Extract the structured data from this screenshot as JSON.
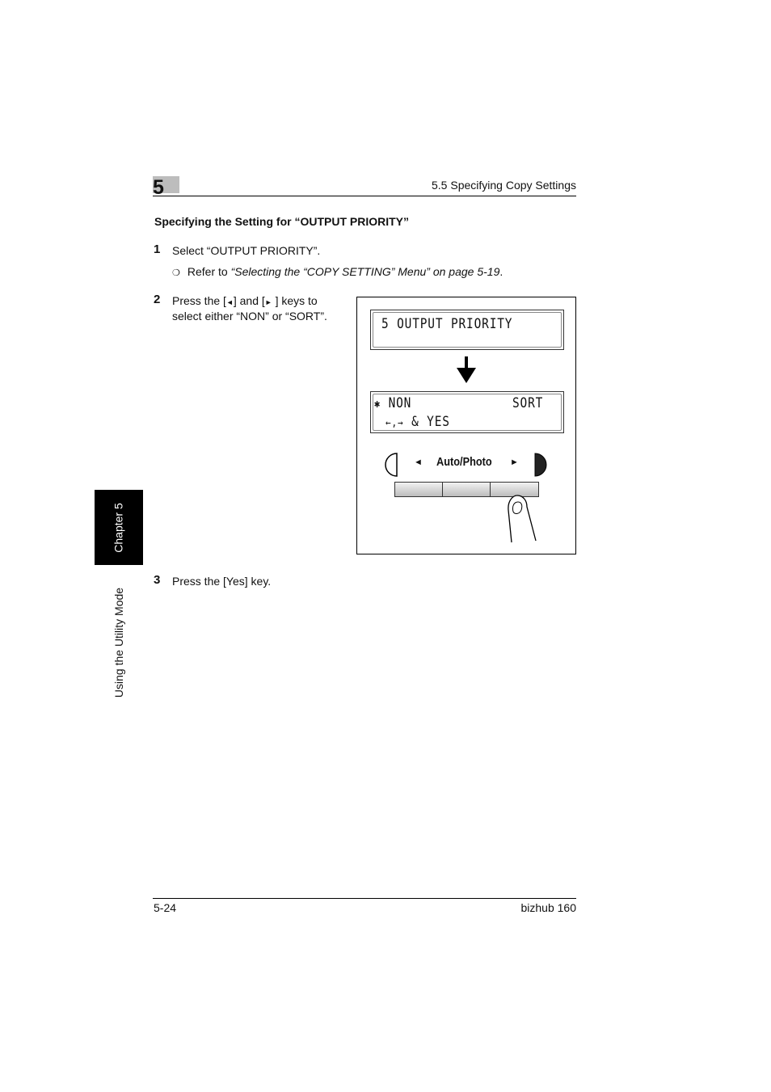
{
  "header": {
    "chapter_number": "5",
    "section_title": "5.5 Specifying Copy Settings"
  },
  "section": {
    "title": "Specifying the Setting for “OUTPUT PRIORITY”"
  },
  "steps": [
    {
      "number": "1",
      "text": "Select “OUTPUT PRIORITY”.",
      "sub": {
        "bullet": "❍",
        "prefix": "Refer to ",
        "link": "“Selecting the “COPY SETTING” Menu” on page 5-19",
        "suffix": "."
      }
    },
    {
      "number": "2",
      "text_line1_a": "Press the [",
      "left_key_icon": "◄",
      "text_line1_b": "] and [",
      "right_key_icon": "►",
      "text_line1_c": " ] keys to",
      "text_line2": "select either “NON” or “SORT”."
    },
    {
      "number": "3",
      "text": "Press the [Yes] key."
    }
  ],
  "figure": {
    "lcd1": {
      "line1": "5  OUTPUT PRIORITY"
    },
    "lcd2": {
      "marker": "✱",
      "option_left": "NON",
      "option_right": "SORT",
      "line2_keys": "←,→",
      "line2_text": "& YES"
    },
    "panel_label": "Auto/Photo",
    "left_arrow": "◄",
    "right_arrow": "►"
  },
  "side_tab": {
    "chapter": "Chapter 5",
    "mode": "Using the Utility Mode"
  },
  "footer": {
    "page": "5-24",
    "product": "bizhub 160"
  }
}
